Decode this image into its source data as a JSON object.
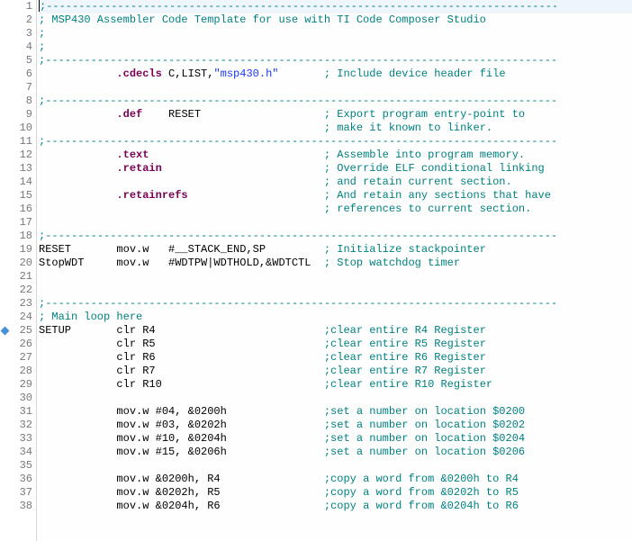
{
  "lines": [
    {
      "n": 1,
      "segs": [
        {
          "t": ";-------------------------------------------------------------------------------",
          "c": "cm"
        }
      ],
      "hl": true,
      "caret": true
    },
    {
      "n": 2,
      "segs": [
        {
          "t": "; MSP430 Assembler Code Template for use with TI Code Composer Studio",
          "c": "cm"
        }
      ]
    },
    {
      "n": 3,
      "segs": [
        {
          "t": ";",
          "c": "cm"
        }
      ]
    },
    {
      "n": 4,
      "segs": [
        {
          "t": ";",
          "c": "cm"
        }
      ]
    },
    {
      "n": 5,
      "segs": [
        {
          "t": ";-------------------------------------------------------------------------------",
          "c": "cm"
        }
      ]
    },
    {
      "n": 6,
      "segs": [
        {
          "t": "            ",
          "c": ""
        },
        {
          "t": ".cdecls",
          "c": "dir"
        },
        {
          "t": " C,LIST,",
          "c": ""
        },
        {
          "t": "\"msp430.h\"",
          "c": "str"
        },
        {
          "t": "       ",
          "c": ""
        },
        {
          "t": "; Include device header file",
          "c": "cm"
        }
      ]
    },
    {
      "n": 7,
      "segs": [
        {
          "t": "",
          "c": ""
        }
      ]
    },
    {
      "n": 8,
      "segs": [
        {
          "t": ";-------------------------------------------------------------------------------",
          "c": "cm"
        }
      ]
    },
    {
      "n": 9,
      "segs": [
        {
          "t": "            ",
          "c": ""
        },
        {
          "t": ".def",
          "c": "dir"
        },
        {
          "t": "    RESET                   ",
          "c": ""
        },
        {
          "t": "; Export program entry-point to",
          "c": "cm"
        }
      ]
    },
    {
      "n": 10,
      "segs": [
        {
          "t": "                                            ",
          "c": ""
        },
        {
          "t": "; make it known to linker.",
          "c": "cm"
        }
      ]
    },
    {
      "n": 11,
      "segs": [
        {
          "t": ";-------------------------------------------------------------------------------",
          "c": "cm"
        }
      ]
    },
    {
      "n": 12,
      "segs": [
        {
          "t": "            ",
          "c": ""
        },
        {
          "t": ".text",
          "c": "dir"
        },
        {
          "t": "                           ",
          "c": ""
        },
        {
          "t": "; Assemble into program memory.",
          "c": "cm"
        }
      ]
    },
    {
      "n": 13,
      "segs": [
        {
          "t": "            ",
          "c": ""
        },
        {
          "t": ".retain",
          "c": "dir"
        },
        {
          "t": "                         ",
          "c": ""
        },
        {
          "t": "; Override ELF conditional linking",
          "c": "cm"
        }
      ]
    },
    {
      "n": 14,
      "segs": [
        {
          "t": "                                            ",
          "c": ""
        },
        {
          "t": "; and retain current section.",
          "c": "cm"
        }
      ]
    },
    {
      "n": 15,
      "segs": [
        {
          "t": "            ",
          "c": ""
        },
        {
          "t": ".retainrefs",
          "c": "dir"
        },
        {
          "t": "                     ",
          "c": ""
        },
        {
          "t": "; And retain any sections that have",
          "c": "cm"
        }
      ]
    },
    {
      "n": 16,
      "segs": [
        {
          "t": "                                            ",
          "c": ""
        },
        {
          "t": "; references to current section.",
          "c": "cm"
        }
      ]
    },
    {
      "n": 17,
      "segs": [
        {
          "t": "",
          "c": ""
        }
      ]
    },
    {
      "n": 18,
      "segs": [
        {
          "t": ";-------------------------------------------------------------------------------",
          "c": "cm"
        }
      ]
    },
    {
      "n": 19,
      "segs": [
        {
          "t": "RESET       mov.w   #__STACK_END,SP         ",
          "c": ""
        },
        {
          "t": "; Initialize stackpointer",
          "c": "cm"
        }
      ]
    },
    {
      "n": 20,
      "segs": [
        {
          "t": "StopWDT     mov.w   #WDTPW|WDTHOLD,&WDTCTL  ",
          "c": ""
        },
        {
          "t": "; Stop watchdog timer",
          "c": "cm"
        }
      ]
    },
    {
      "n": 21,
      "segs": [
        {
          "t": "",
          "c": ""
        }
      ]
    },
    {
      "n": 22,
      "segs": [
        {
          "t": "",
          "c": ""
        }
      ]
    },
    {
      "n": 23,
      "segs": [
        {
          "t": ";-------------------------------------------------------------------------------",
          "c": "cm"
        }
      ]
    },
    {
      "n": 24,
      "segs": [
        {
          "t": "; Main loop here",
          "c": "cm"
        }
      ]
    },
    {
      "n": 25,
      "segs": [
        {
          "t": "SETUP       clr R4                          ",
          "c": ""
        },
        {
          "t": ";clear entire R4 Register",
          "c": "cm"
        }
      ],
      "marker": true
    },
    {
      "n": 26,
      "segs": [
        {
          "t": "            clr R5                          ",
          "c": ""
        },
        {
          "t": ";clear entire R5 Register",
          "c": "cm"
        }
      ]
    },
    {
      "n": 27,
      "segs": [
        {
          "t": "            clr R6                          ",
          "c": ""
        },
        {
          "t": ";clear entire R6 Register",
          "c": "cm"
        }
      ]
    },
    {
      "n": 28,
      "segs": [
        {
          "t": "            clr R7                          ",
          "c": ""
        },
        {
          "t": ";clear entire R7 Register",
          "c": "cm"
        }
      ]
    },
    {
      "n": 29,
      "segs": [
        {
          "t": "            clr R10                         ",
          "c": ""
        },
        {
          "t": ";clear entire R10 Register",
          "c": "cm"
        }
      ]
    },
    {
      "n": 30,
      "segs": [
        {
          "t": "",
          "c": ""
        }
      ]
    },
    {
      "n": 31,
      "segs": [
        {
          "t": "            mov.w #04, &0200h               ",
          "c": ""
        },
        {
          "t": ";set a number on location $0200",
          "c": "cm"
        }
      ]
    },
    {
      "n": 32,
      "segs": [
        {
          "t": "            mov.w #03, &0202h               ",
          "c": ""
        },
        {
          "t": ";set a number on location $0202",
          "c": "cm"
        }
      ]
    },
    {
      "n": 33,
      "segs": [
        {
          "t": "            mov.w #10, &0204h               ",
          "c": ""
        },
        {
          "t": ";set a number on location $0204",
          "c": "cm"
        }
      ]
    },
    {
      "n": 34,
      "segs": [
        {
          "t": "            mov.w #15, &0206h               ",
          "c": ""
        },
        {
          "t": ";set a number on location $0206",
          "c": "cm"
        }
      ]
    },
    {
      "n": 35,
      "segs": [
        {
          "t": "",
          "c": ""
        }
      ]
    },
    {
      "n": 36,
      "segs": [
        {
          "t": "            mov.w &0200h, R4                ",
          "c": ""
        },
        {
          "t": ";copy a word from &0200h to R4",
          "c": "cm"
        }
      ]
    },
    {
      "n": 37,
      "segs": [
        {
          "t": "            mov.w &0202h, R5                ",
          "c": ""
        },
        {
          "t": ";copy a word from &0202h to R5",
          "c": "cm"
        }
      ]
    },
    {
      "n": 38,
      "segs": [
        {
          "t": "            mov.w &0204h, R6                ",
          "c": ""
        },
        {
          "t": ";copy a word from &0204h to R6",
          "c": "cm"
        }
      ]
    }
  ]
}
